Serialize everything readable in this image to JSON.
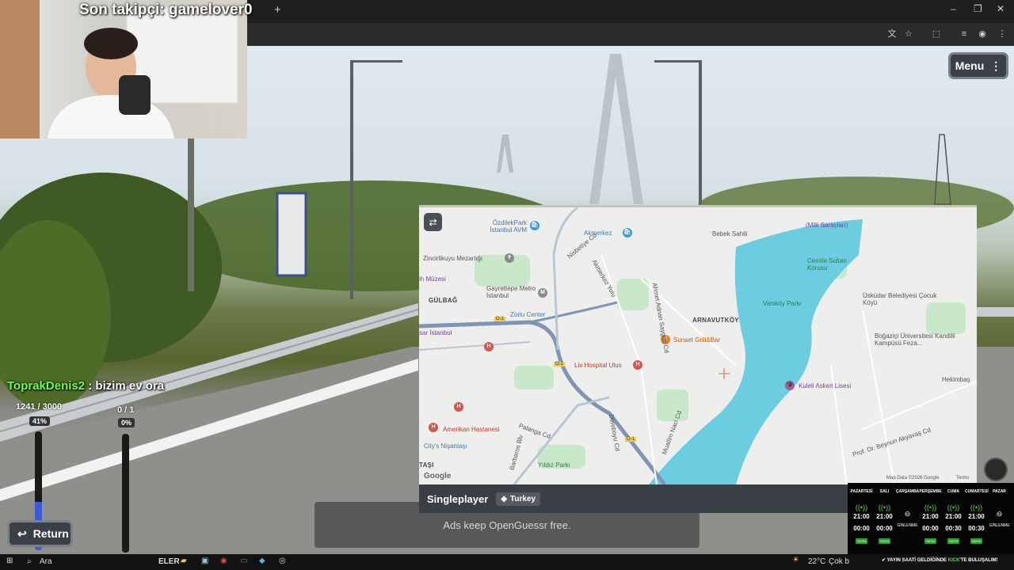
{
  "overlay": {
    "follower_text": "Son takipçi: gamelover0",
    "chat_user": "ToprakDenis2",
    "chat_message": " : bizim ev ora"
  },
  "browser": {
    "new_tab": "+",
    "minimize": "–",
    "restore": "❐",
    "close": "✕"
  },
  "game": {
    "menu_label": "Menu",
    "return_label": "Return",
    "bar1": {
      "label": "1241 / 3000",
      "percent_label": "41%",
      "fill": 0.41,
      "color": "#3d5bd6"
    },
    "bar2": {
      "label": "0 / 1",
      "percent_label": "0%",
      "fill": 0.0,
      "color": "#d8a93a"
    },
    "mode_label": "Singleplayer",
    "country": "Turkey",
    "ads_text": "Ads keep OpenGuessr free."
  },
  "map": {
    "labels": {
      "ozdilek": "ÖzdilekPark İstanbul AVM",
      "akmerkez": "Akmerkez",
      "bebek": "Bebek Sahili",
      "milli": "(Milli Sarayları)",
      "zincirlikuyu": "Zincirlikuyu Mezarlığı",
      "cemile": "Cemile Sultan Korusu",
      "muzesi": "ih Müzesi",
      "gulbag": "GÜLBAĞ",
      "gayrettepe": "Gayrettepe Metro İstanbul",
      "zorlu": "Zorlu Center",
      "arnavutkoy": "ARNAVUTKÖY",
      "vanikoy": "Vaniköy Parkı",
      "uskudar": "Üsküdar Belediyesi Çocuk Köyü",
      "sunset": "Sunset Grill&Bar",
      "sar_istanbul": "sar İstanbul",
      "bogazici": "Boğaziçi Üniversitesi Kandilli Kampüsü Feza...",
      "livhospital": "Liv Hospital Ulus",
      "hekimbasi": "Hekimbaş",
      "kuleli": "Kuleli Askeri Lisesi",
      "amerikan": "Amerikan Hastanesi",
      "citys": "City's Nişantaşı",
      "yildiz": "Yıldız Parkı",
      "tasi": "TAŞI",
      "google": "Google",
      "mapdata": "Map Data ©2026 Google",
      "terms": "Terms",
      "nisbetiye": "Nisbetiye Cd",
      "akmerkez_yolu": "Akmerkez Yolu",
      "ahmet_adnan": "Ahmet Adnan Saygun Cd",
      "muallim": "Muallim Naci Cd",
      "dereboyu": "Dereboyu Cd",
      "prof": "Prof. Dr. Beynun Akyavaş Cd",
      "palanga": "Palanga Cd",
      "barbaros": "Barbaros Blv",
      "o1a": "O-1",
      "o1b": "O-1",
      "o1c": "O-1"
    }
  },
  "schedule": {
    "days": [
      {
        "name": "PAZARTESİ",
        "start": "21:00",
        "end": "00:00",
        "tag": "YAYIN"
      },
      {
        "name": "SALI",
        "start": "21:00",
        "end": "00:00",
        "tag": "YAYIN"
      },
      {
        "name": "ÇARŞAMBA",
        "off": "GİNLENME"
      },
      {
        "name": "PERŞEMBE",
        "start": "21:00",
        "end": "00:00",
        "tag": "YAYIN"
      },
      {
        "name": "CUMA",
        "start": "21:00",
        "end": "00:30",
        "tag": "YAYIN"
      },
      {
        "name": "CUMARTESİ",
        "start": "21:00",
        "end": "00:30",
        "tag": "YAYIN"
      },
      {
        "name": "PAZAR",
        "off": "GİNLENME"
      }
    ],
    "promo_pre": "YAYIN SAATİ GELDİĞİNDE ",
    "promo_brand": "KICK",
    "promo_post": "'TE BULUŞALIM!"
  },
  "taskbar": {
    "search_label": "Ara",
    "app_label": "ELER",
    "weather_temp": "22°C",
    "weather_desc": "Çok b"
  },
  "colors": {
    "accent_green": "#55e055",
    "water": "#6ccde0",
    "road_blue": "#7f95b6",
    "park": "#c9e8c9"
  }
}
